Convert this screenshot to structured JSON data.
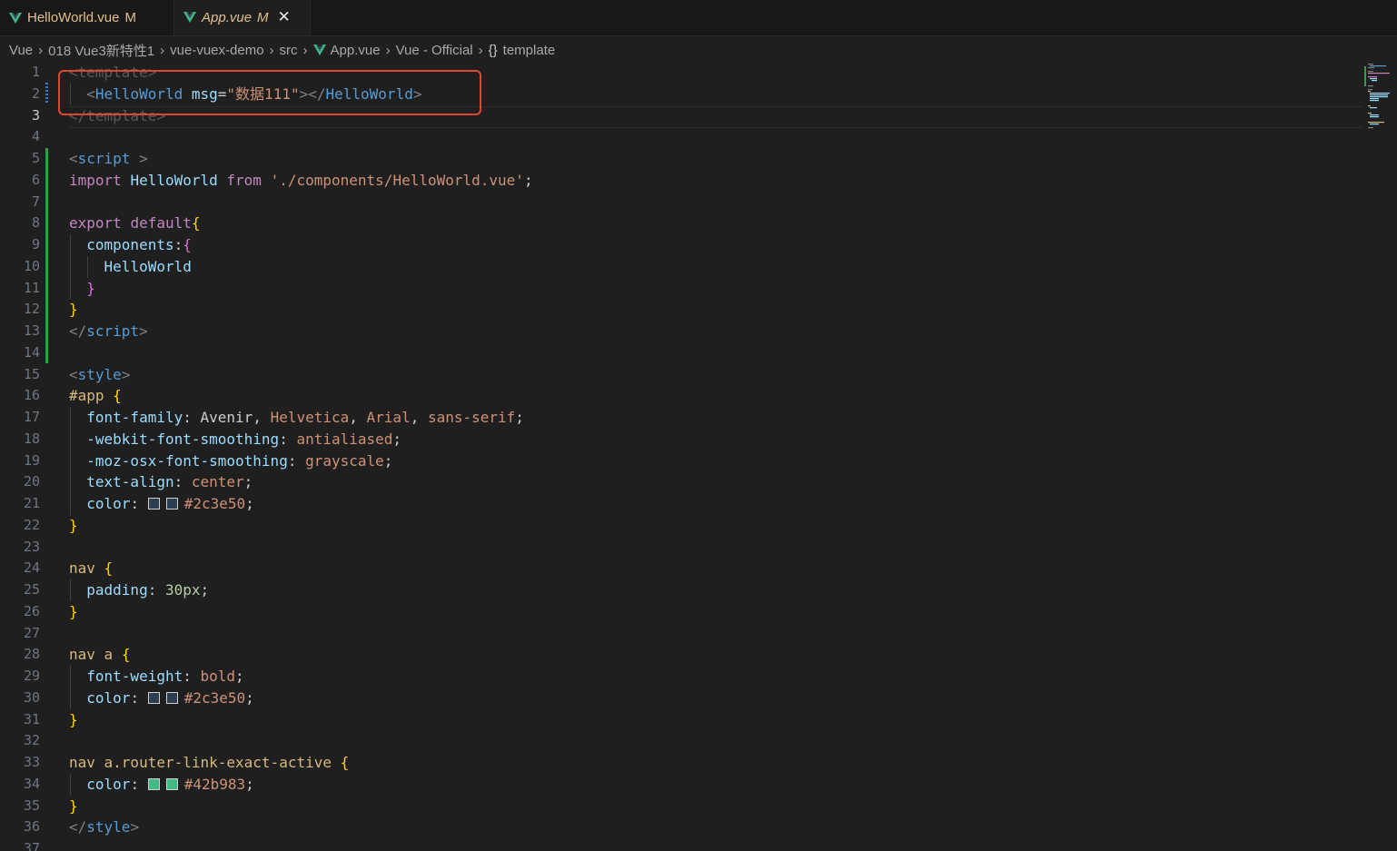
{
  "tabs": [
    {
      "label": "HelloWorld.vue",
      "status": "M",
      "active": false
    },
    {
      "label": "App.vue",
      "status": "M",
      "active": true,
      "close": "✕"
    }
  ],
  "breadcrumb": [
    "Vue",
    "018 Vue3新特性1",
    "vue-vuex-demo",
    "src",
    "App.vue",
    "Vue - Official",
    "template"
  ],
  "breadcrumb_braces": "{}",
  "colors": {
    "vue_icon": "#41b883",
    "highlight_box": "#e0452f",
    "swatch_dark": "#2c3e50",
    "swatch_green": "#42b983"
  },
  "editor": {
    "current_line": 3,
    "lines": [
      {
        "n": "1",
        "tokens": [
          [
            "faded",
            "<"
          ],
          [
            "faded",
            "template"
          ],
          [
            "faded",
            ">"
          ]
        ]
      },
      {
        "n": "2",
        "tokens": [
          [
            "def",
            "  "
          ],
          [
            "tag",
            "<"
          ],
          [
            "name",
            "HelloWorld"
          ],
          [
            "def",
            " "
          ],
          [
            "attr",
            "msg"
          ],
          [
            "def",
            "="
          ],
          [
            "str",
            "\"数据111\""
          ],
          [
            "tag",
            "></"
          ],
          [
            "name",
            "HelloWorld"
          ],
          [
            "tag",
            ">"
          ]
        ]
      },
      {
        "n": "3",
        "tokens": [
          [
            "faded",
            "</"
          ],
          [
            "faded",
            "template"
          ],
          [
            "faded",
            ">"
          ]
        ]
      },
      {
        "n": "4",
        "tokens": []
      },
      {
        "n": "5",
        "tokens": [
          [
            "tag",
            "<"
          ],
          [
            "name",
            "script"
          ],
          [
            "def",
            " "
          ],
          [
            "tag",
            ">"
          ]
        ]
      },
      {
        "n": "6",
        "tokens": [
          [
            "kw",
            "import"
          ],
          [
            "def",
            " "
          ],
          [
            "var",
            "HelloWorld"
          ],
          [
            "def",
            " "
          ],
          [
            "kw",
            "from"
          ],
          [
            "def",
            " "
          ],
          [
            "str",
            "'./components/HelloWorld.vue'"
          ],
          [
            "def",
            ";"
          ]
        ]
      },
      {
        "n": "7",
        "tokens": []
      },
      {
        "n": "8",
        "tokens": [
          [
            "kw",
            "export"
          ],
          [
            "def",
            " "
          ],
          [
            "kw",
            "default"
          ],
          [
            "brace1",
            "{"
          ]
        ]
      },
      {
        "n": "9",
        "tokens": [
          [
            "def",
            "  "
          ],
          [
            "var",
            "components"
          ],
          [
            "def",
            ":"
          ],
          [
            "brace2",
            "{"
          ]
        ]
      },
      {
        "n": "10",
        "tokens": [
          [
            "def",
            "    "
          ],
          [
            "var",
            "HelloWorld"
          ]
        ]
      },
      {
        "n": "11",
        "tokens": [
          [
            "def",
            "  "
          ],
          [
            "brace2",
            "}"
          ]
        ]
      },
      {
        "n": "12",
        "tokens": [
          [
            "brace1",
            "}"
          ]
        ]
      },
      {
        "n": "13",
        "tokens": [
          [
            "tag",
            "</"
          ],
          [
            "name",
            "script"
          ],
          [
            "tag",
            ">"
          ]
        ]
      },
      {
        "n": "14",
        "tokens": []
      },
      {
        "n": "15",
        "tokens": [
          [
            "tag",
            "<"
          ],
          [
            "name",
            "style"
          ],
          [
            "tag",
            ">"
          ]
        ]
      },
      {
        "n": "16",
        "tokens": [
          [
            "sel",
            "#app"
          ],
          [
            "def",
            " "
          ],
          [
            "brace1",
            "{"
          ]
        ]
      },
      {
        "n": "17",
        "tokens": [
          [
            "def",
            "  "
          ],
          [
            "prop",
            "font-family"
          ],
          [
            "def",
            ": "
          ],
          [
            "def",
            "Avenir"
          ],
          [
            "def",
            ", "
          ],
          [
            "val",
            "Helvetica"
          ],
          [
            "def",
            ", "
          ],
          [
            "val",
            "Arial"
          ],
          [
            "def",
            ", "
          ],
          [
            "val",
            "sans-serif"
          ],
          [
            "def",
            ";"
          ]
        ]
      },
      {
        "n": "18",
        "tokens": [
          [
            "def",
            "  "
          ],
          [
            "prop",
            "-webkit-font-smoothing"
          ],
          [
            "def",
            ": "
          ],
          [
            "val",
            "antialiased"
          ],
          [
            "def",
            ";"
          ]
        ]
      },
      {
        "n": "19",
        "tokens": [
          [
            "def",
            "  "
          ],
          [
            "prop",
            "-moz-osx-font-smoothing"
          ],
          [
            "def",
            ": "
          ],
          [
            "val",
            "grayscale"
          ],
          [
            "def",
            ";"
          ]
        ]
      },
      {
        "n": "20",
        "tokens": [
          [
            "def",
            "  "
          ],
          [
            "prop",
            "text-align"
          ],
          [
            "def",
            ": "
          ],
          [
            "val",
            "center"
          ],
          [
            "def",
            ";"
          ]
        ]
      },
      {
        "n": "21",
        "tokens": [
          [
            "def",
            "  "
          ],
          [
            "prop",
            "color"
          ],
          [
            "def",
            ": "
          ],
          [
            "swatch",
            "#2c3e50"
          ],
          [
            "swatch",
            "#2c3e50"
          ],
          [
            "val",
            "#2c3e50"
          ],
          [
            "def",
            ";"
          ]
        ]
      },
      {
        "n": "22",
        "tokens": [
          [
            "brace1",
            "}"
          ]
        ]
      },
      {
        "n": "23",
        "tokens": []
      },
      {
        "n": "24",
        "tokens": [
          [
            "sel",
            "nav"
          ],
          [
            "def",
            " "
          ],
          [
            "brace1",
            "{"
          ]
        ]
      },
      {
        "n": "25",
        "tokens": [
          [
            "def",
            "  "
          ],
          [
            "prop",
            "padding"
          ],
          [
            "def",
            ": "
          ],
          [
            "num",
            "30px"
          ],
          [
            "def",
            ";"
          ]
        ]
      },
      {
        "n": "26",
        "tokens": [
          [
            "brace1",
            "}"
          ]
        ]
      },
      {
        "n": "27",
        "tokens": []
      },
      {
        "n": "28",
        "tokens": [
          [
            "sel",
            "nav a"
          ],
          [
            "def",
            " "
          ],
          [
            "brace1",
            "{"
          ]
        ]
      },
      {
        "n": "29",
        "tokens": [
          [
            "def",
            "  "
          ],
          [
            "prop",
            "font-weight"
          ],
          [
            "def",
            ": "
          ],
          [
            "val",
            "bold"
          ],
          [
            "def",
            ";"
          ]
        ]
      },
      {
        "n": "30",
        "tokens": [
          [
            "def",
            "  "
          ],
          [
            "prop",
            "color"
          ],
          [
            "def",
            ": "
          ],
          [
            "swatch",
            "#2c3e50"
          ],
          [
            "swatch",
            "#2c3e50"
          ],
          [
            "val",
            "#2c3e50"
          ],
          [
            "def",
            ";"
          ]
        ]
      },
      {
        "n": "31",
        "tokens": [
          [
            "brace1",
            "}"
          ]
        ]
      },
      {
        "n": "32",
        "tokens": []
      },
      {
        "n": "33",
        "tokens": [
          [
            "sel",
            "nav a.router-link-exact-active"
          ],
          [
            "def",
            " "
          ],
          [
            "brace1",
            "{"
          ]
        ]
      },
      {
        "n": "34",
        "tokens": [
          [
            "def",
            "  "
          ],
          [
            "prop",
            "color"
          ],
          [
            "def",
            ": "
          ],
          [
            "swatch",
            "#42b983"
          ],
          [
            "swatch",
            "#42b983"
          ],
          [
            "val",
            "#42b983"
          ],
          [
            "def",
            ";"
          ]
        ]
      },
      {
        "n": "35",
        "tokens": [
          [
            "brace1",
            "}"
          ]
        ]
      },
      {
        "n": "36",
        "tokens": [
          [
            "tag",
            "</"
          ],
          [
            "name",
            "style"
          ],
          [
            "tag",
            ">"
          ]
        ]
      },
      {
        "n": "37",
        "tokens": []
      }
    ]
  }
}
